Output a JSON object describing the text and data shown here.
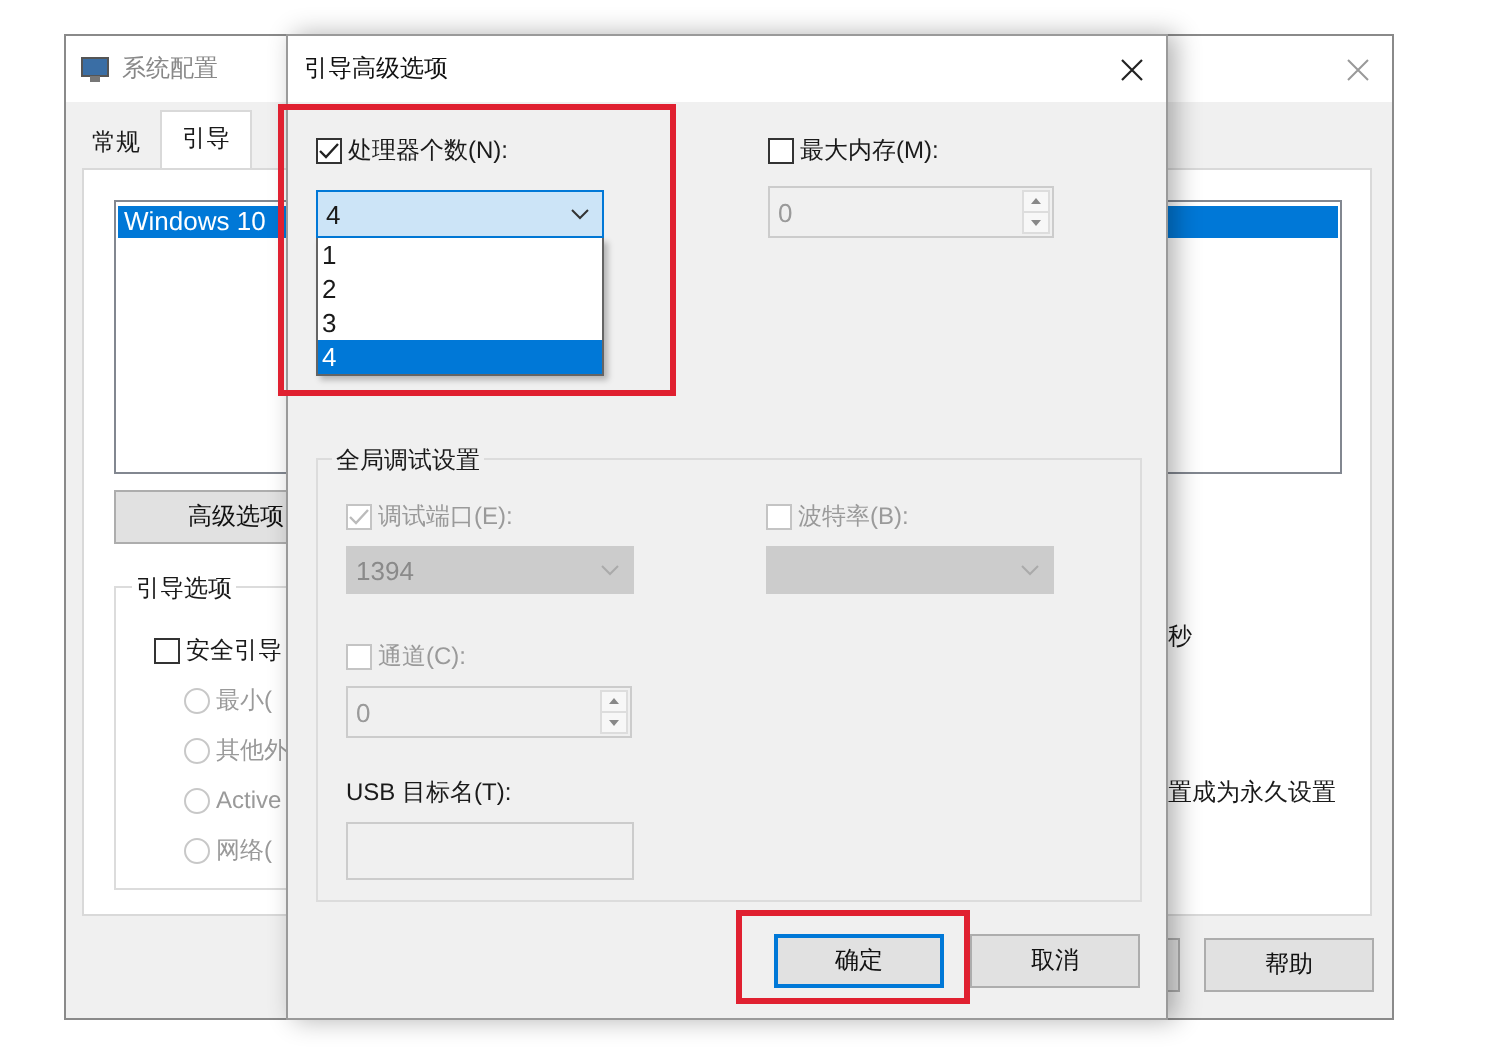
{
  "background_window": {
    "title": "系统配置",
    "tabs": [
      {
        "label": "常规",
        "selected": false
      },
      {
        "label": "引导",
        "selected": true
      }
    ],
    "os_list": [
      {
        "label": "Windows 10",
        "selected": true
      }
    ],
    "advanced_button": "高级选项",
    "boot_options": {
      "title": "引导选项",
      "safe_boot": {
        "label": "安全引导",
        "checked": false
      },
      "modes": [
        {
          "label": "最小(",
          "selected": false,
          "disabled": true
        },
        {
          "label": "其他外",
          "selected": false,
          "disabled": true
        },
        {
          "label": "Active",
          "selected": false,
          "disabled": true
        },
        {
          "label": "网络(",
          "selected": false,
          "disabled": true
        }
      ]
    },
    "right_texts": [
      "秒",
      "置成为永久设置"
    ],
    "buttons": [
      {
        "label": "帮助"
      }
    ]
  },
  "dialog": {
    "title": "引导高级选项",
    "processors": {
      "label": "处理器个数(N):",
      "checked": true,
      "value": "4",
      "options": [
        {
          "label": "1",
          "selected": false
        },
        {
          "label": "2",
          "selected": false
        },
        {
          "label": "3",
          "selected": false
        },
        {
          "label": "4",
          "selected": true
        }
      ]
    },
    "max_memory": {
      "label": "最大内存(M):",
      "checked": false,
      "disabled": true,
      "value": "0"
    },
    "debug": {
      "title": "全局调试设置",
      "port": {
        "label": "调试端口(E):",
        "checked": true,
        "disabled": true,
        "value": "1394"
      },
      "baud": {
        "label": "波特率(B):",
        "checked": false,
        "disabled": true
      },
      "channel": {
        "label": "通道(C):",
        "checked": false,
        "disabled": true,
        "value": "0"
      },
      "usb": {
        "label": "USB 目标名(T):",
        "disabled": true
      }
    },
    "buttons": [
      {
        "label": "确定",
        "default": true
      },
      {
        "label": "取消",
        "default": false
      }
    ]
  }
}
